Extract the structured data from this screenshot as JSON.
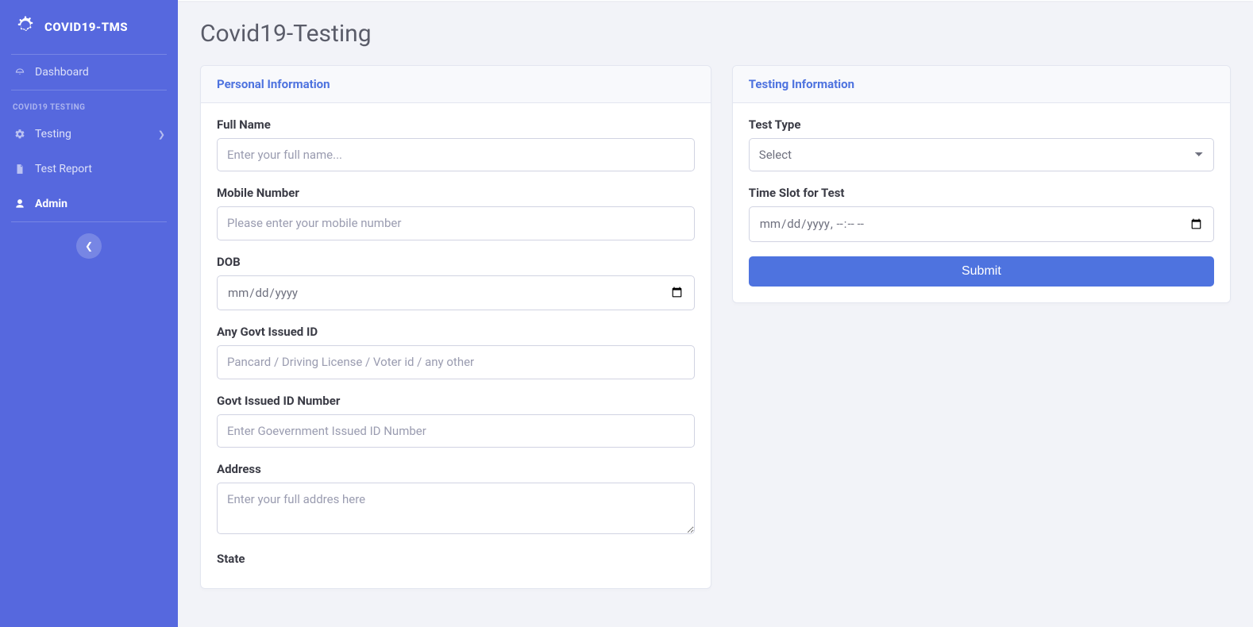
{
  "brand": "COVID19-TMS",
  "sidebar": {
    "items": {
      "dashboard": "Dashboard",
      "testing": "Testing",
      "report": "Test Report",
      "admin": "Admin"
    },
    "section_heading": "COVID19 TESTING"
  },
  "page": {
    "title": "Covid19-Testing"
  },
  "cards": {
    "personal": {
      "header": "Personal Information",
      "fields": {
        "fullname": {
          "label": "Full Name",
          "placeholder": "Enter your full name..."
        },
        "mobile": {
          "label": "Mobile Number",
          "placeholder": "Please enter your mobile number"
        },
        "dob": {
          "label": "DOB",
          "placeholder": "mm/dd/yyyy"
        },
        "govtid": {
          "label": "Any Govt Issued ID",
          "placeholder": "Pancard / Driving License / Voter id / any other"
        },
        "govtidnum": {
          "label": "Govt Issued ID Number",
          "placeholder": "Enter Goevernment Issued ID Number"
        },
        "address": {
          "label": "Address",
          "placeholder": "Enter your full addres here"
        },
        "state": {
          "label": "State"
        }
      }
    },
    "testing": {
      "header": "Testing Information",
      "fields": {
        "testtype": {
          "label": "Test Type",
          "selected": "Select"
        },
        "timeslot": {
          "label": "Time Slot for Test",
          "placeholder": "mm/dd/yyyy --:-- --"
        }
      },
      "submit_label": "Submit"
    }
  }
}
